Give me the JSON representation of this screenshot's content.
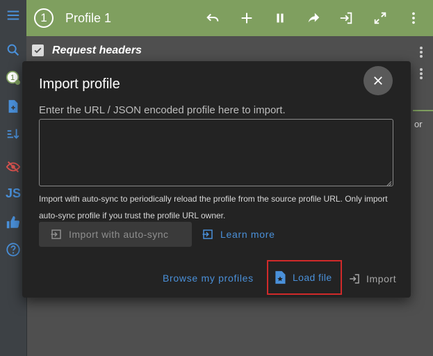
{
  "header": {
    "profile_number": "1",
    "title": "Profile 1"
  },
  "sidebar": {
    "profile_badge": "1",
    "json_label": "JS"
  },
  "background": {
    "request_headers_label": "Request headers",
    "truncated_text": "or"
  },
  "dialog": {
    "title": "Import profile",
    "prompt": "Enter the URL / JSON encoded profile here to import.",
    "textarea_value": "",
    "note": "Import with auto-sync to periodically reload the profile from the source profile URL. Only import auto-sync profile if you trust the profile URL owner.",
    "import_auto_sync_label": "Import with auto-sync",
    "learn_more_label": "Learn more",
    "browse_label": "Browse my profiles",
    "load_file_label": "Load file",
    "import_label": "Import"
  },
  "colors": {
    "header_bg": "#7f9f5f",
    "accent_link": "#4a90d9",
    "highlight_box": "#d12a2a",
    "dialog_bg": "#232323"
  }
}
